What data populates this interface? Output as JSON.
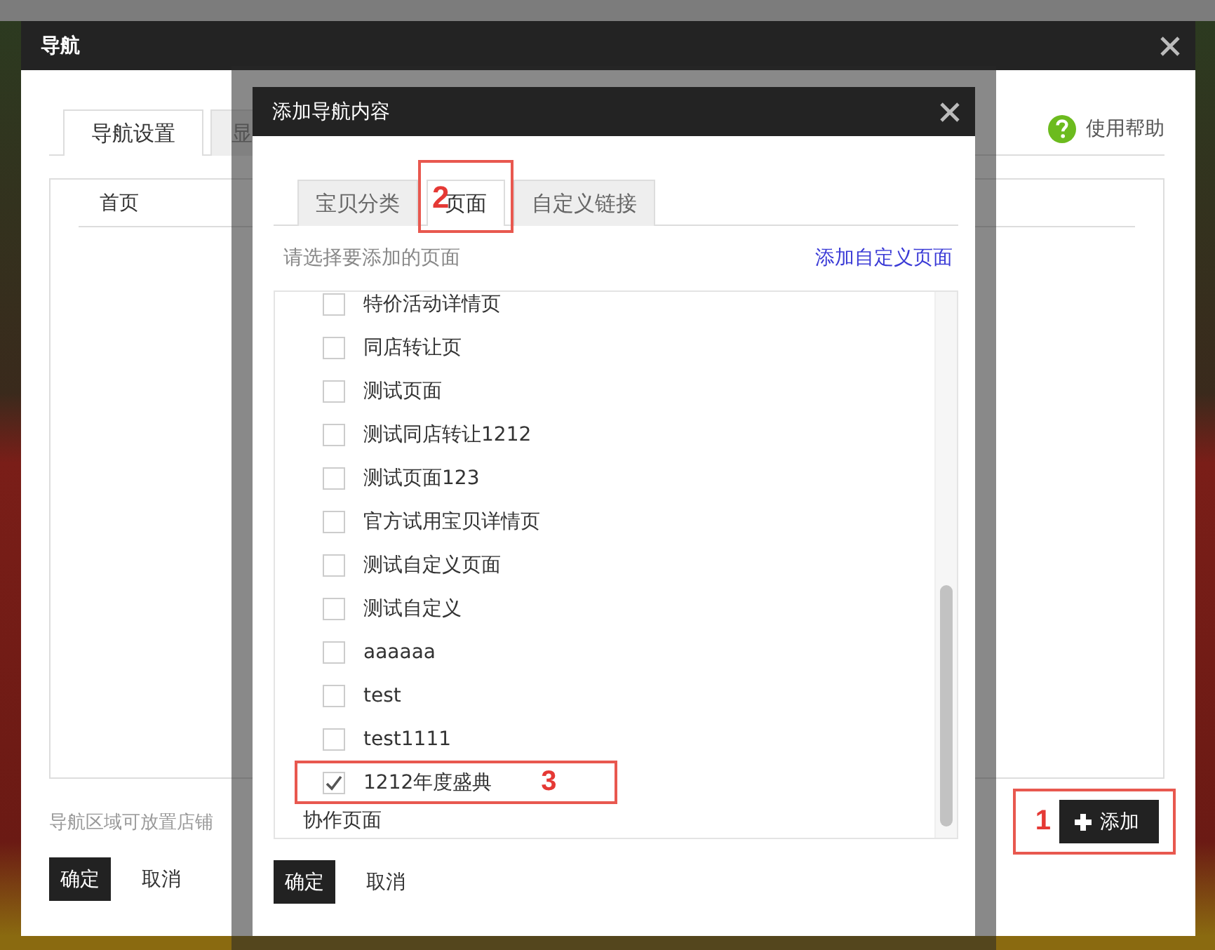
{
  "outer_dialog": {
    "title": "导航",
    "tabs": [
      {
        "label": "导航设置",
        "selected": true
      },
      {
        "label": "显",
        "selected": false
      }
    ],
    "help_link": "使用帮助",
    "nav_items": [
      "首页"
    ],
    "hint": "导航区域可放置店铺",
    "add_button": {
      "label": "添加",
      "annotation": "1"
    },
    "buttons": [
      {
        "label": "确定",
        "kind": "primary"
      },
      {
        "label": "取消",
        "kind": "plain"
      }
    ]
  },
  "inner_dialog": {
    "title": "添加导航内容",
    "tabs": [
      {
        "label": "宝贝分类",
        "selected": false
      },
      {
        "label": "页面",
        "selected": true,
        "annotation": "2"
      },
      {
        "label": "自定义链接",
        "selected": false
      }
    ],
    "hint": "请选择要添加的页面",
    "custom_page_link": "添加自定义页面",
    "pages": [
      {
        "kind": "option",
        "label": "特价活动详情页",
        "checked": false
      },
      {
        "kind": "option",
        "label": "同店转让页",
        "checked": false
      },
      {
        "kind": "option",
        "label": "测试页面",
        "checked": false
      },
      {
        "kind": "option",
        "label": "测试同店转让1212",
        "checked": false
      },
      {
        "kind": "option",
        "label": "测试页面123",
        "checked": false
      },
      {
        "kind": "option",
        "label": "官方试用宝贝详情页",
        "checked": false
      },
      {
        "kind": "option",
        "label": "测试自定义页面",
        "checked": false
      },
      {
        "kind": "option",
        "label": "测试自定义",
        "checked": false
      },
      {
        "kind": "option",
        "label": "aaaaaa",
        "checked": false
      },
      {
        "kind": "option",
        "label": "test",
        "checked": false
      },
      {
        "kind": "option",
        "label": "test1111",
        "checked": false
      },
      {
        "kind": "option",
        "label": "1212年度盛典",
        "checked": true,
        "annotation": "3"
      },
      {
        "kind": "group",
        "label": "协作页面"
      }
    ],
    "buttons": [
      {
        "label": "确定",
        "kind": "primary"
      },
      {
        "label": "取消",
        "kind": "plain"
      }
    ]
  }
}
